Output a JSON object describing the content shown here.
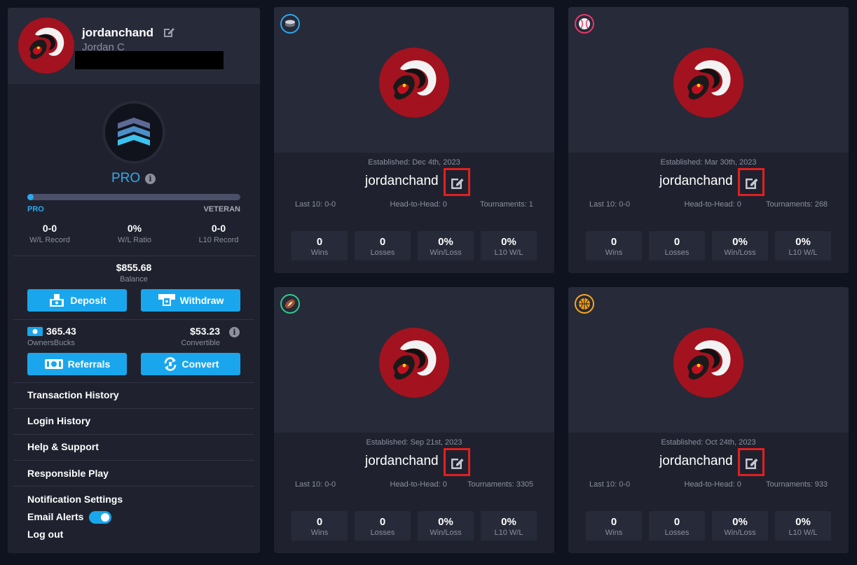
{
  "profile": {
    "username": "jordanchand",
    "real_name": "Jordan C"
  },
  "rank": {
    "label": "PRO",
    "progress_percent": 2,
    "from_label": "PRO",
    "to_label": "VETERAN"
  },
  "record": [
    {
      "value": "0-0",
      "label": "W/L Record"
    },
    {
      "value": "0%",
      "label": "W/L Ratio"
    },
    {
      "value": "0-0",
      "label": "L10 Record"
    }
  ],
  "balance": {
    "value": "$855.68",
    "label": "Balance"
  },
  "buttons": {
    "deposit": "Deposit",
    "withdraw": "Withdraw",
    "referrals": "Referrals",
    "convert": "Convert"
  },
  "owners_bucks": {
    "value": "365.43",
    "label": "OwnersBucks"
  },
  "convertible": {
    "value": "$53.23",
    "label": "Convertible"
  },
  "menu": {
    "transaction_history": "Transaction History",
    "login_history": "Login History",
    "help_support": "Help & Support",
    "responsible_play": "Responsible Play",
    "notification_settings": "Notification Settings",
    "email_alerts": "Email Alerts",
    "logout": "Log out"
  },
  "email_alerts_on": true,
  "colors": {
    "accent": "#1aa6ed",
    "highlight": "#e02020",
    "team_red": "#a3121f"
  },
  "teams": [
    {
      "sport_icon": "hockey-puck-icon",
      "sport_color": "#2ba8ef",
      "established": "Established: Dec 4th, 2023",
      "name": "jordanchand",
      "last10": "Last 10: 0-0",
      "h2h": "Head-to-Head: 0",
      "tournaments": "Tournaments: 1",
      "stats": [
        {
          "value": "0",
          "label": "Wins"
        },
        {
          "value": "0",
          "label": "Losses"
        },
        {
          "value": "0%",
          "label": "Win/Loss"
        },
        {
          "value": "0%",
          "label": "L10 W/L"
        }
      ]
    },
    {
      "sport_icon": "baseball-icon",
      "sport_color": "#e8386e",
      "established": "Established: Mar 30th, 2023",
      "name": "jordanchand",
      "last10": "Last 10: 0-0",
      "h2h": "Head-to-Head: 0",
      "tournaments": "Tournaments: 268",
      "stats": [
        {
          "value": "0",
          "label": "Wins"
        },
        {
          "value": "0",
          "label": "Losses"
        },
        {
          "value": "0%",
          "label": "Win/Loss"
        },
        {
          "value": "0%",
          "label": "L10 W/L"
        }
      ]
    },
    {
      "sport_icon": "football-icon",
      "sport_color": "#2ecc8a",
      "established": "Established: Sep 21st, 2023",
      "name": "jordanchand",
      "last10": "Last 10: 0-0",
      "h2h": "Head-to-Head: 0",
      "tournaments": "Tournaments: 3305",
      "stats": [
        {
          "value": "0",
          "label": "Wins"
        },
        {
          "value": "0",
          "label": "Losses"
        },
        {
          "value": "0%",
          "label": "Win/Loss"
        },
        {
          "value": "0%",
          "label": "L10 W/L"
        }
      ]
    },
    {
      "sport_icon": "basketball-icon",
      "sport_color": "#f5a623",
      "established": "Established: Oct 24th, 2023",
      "name": "jordanchand",
      "last10": "Last 10: 0-0",
      "h2h": "Head-to-Head: 0",
      "tournaments": "Tournaments: 933",
      "stats": [
        {
          "value": "0",
          "label": "Wins"
        },
        {
          "value": "0",
          "label": "Losses"
        },
        {
          "value": "0%",
          "label": "Win/Loss"
        },
        {
          "value": "0%",
          "label": "L10 W/L"
        }
      ]
    }
  ]
}
